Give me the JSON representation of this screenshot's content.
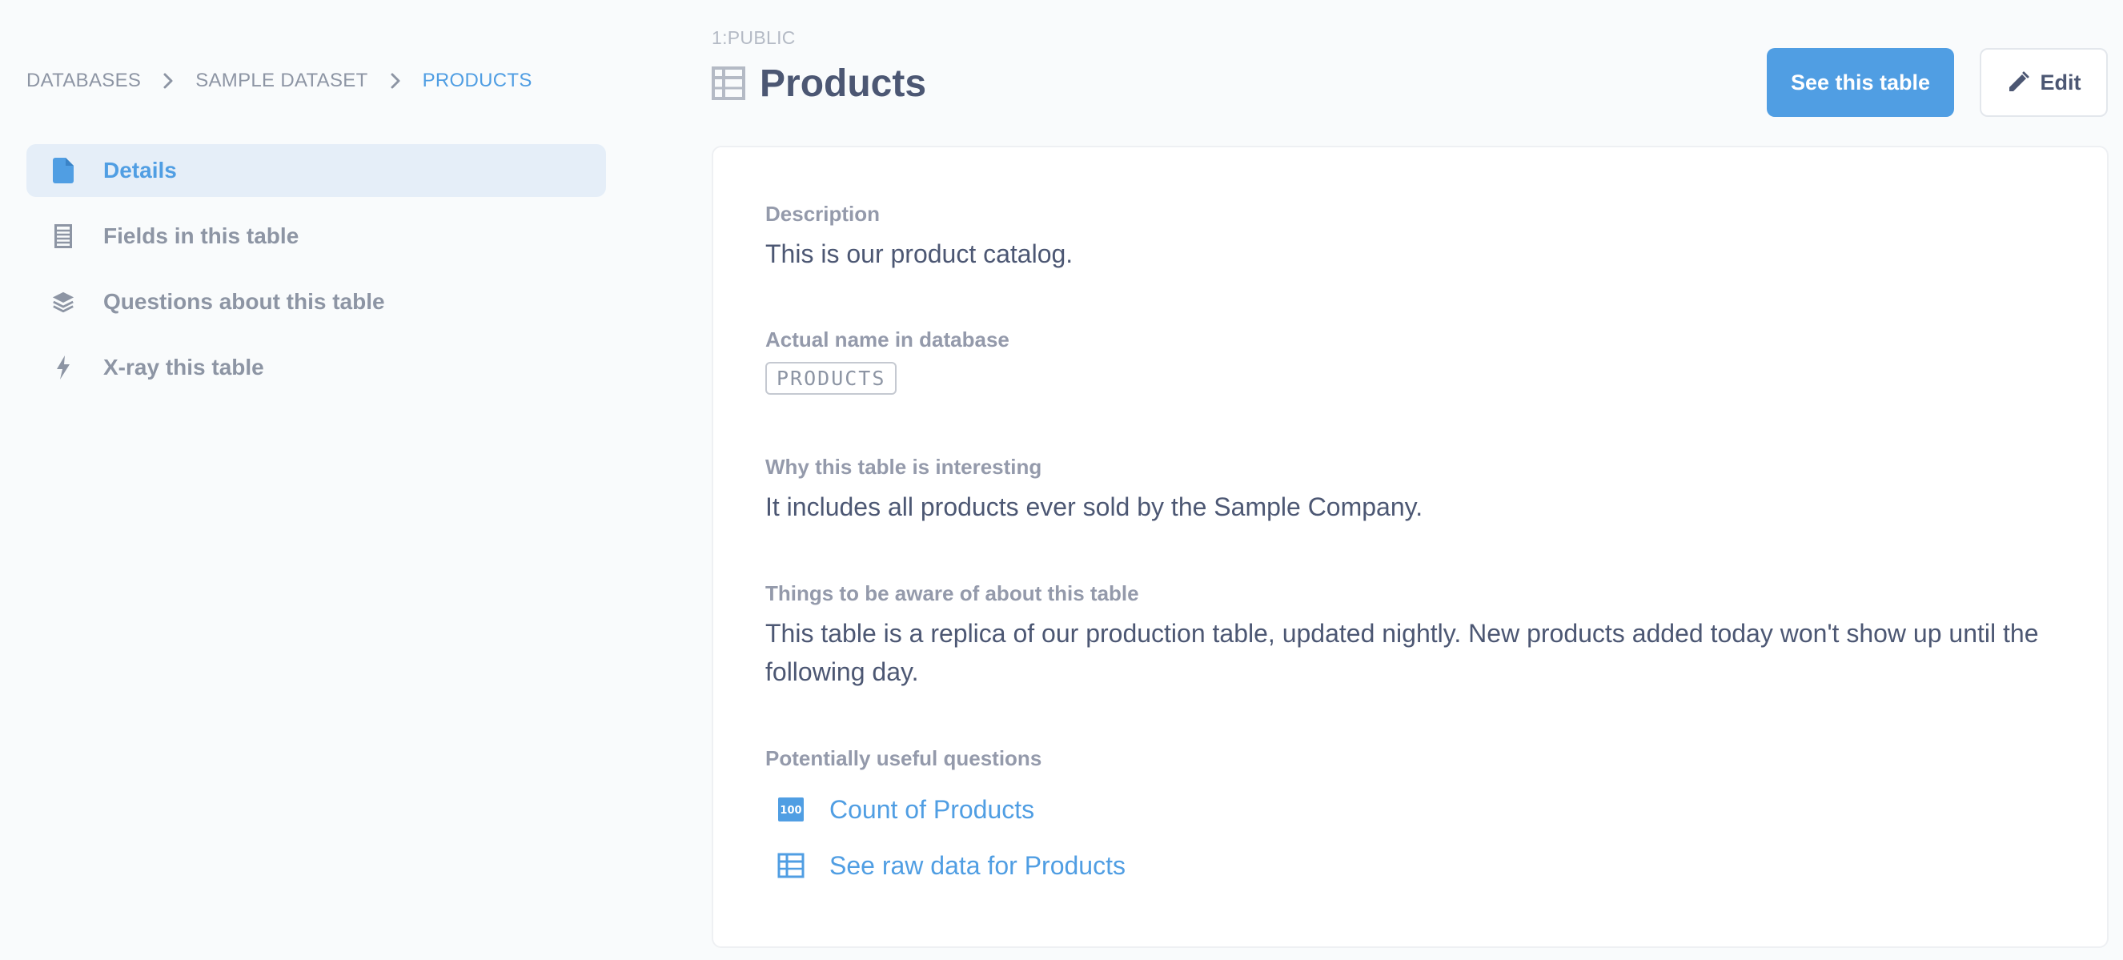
{
  "breadcrumb": {
    "items": [
      "DATABASES",
      "SAMPLE DATASET",
      "PRODUCTS"
    ]
  },
  "sidebar": {
    "items": [
      {
        "label": "Details",
        "icon": "document-icon",
        "active": true
      },
      {
        "label": "Fields in this table",
        "icon": "list-icon",
        "active": false
      },
      {
        "label": "Questions about this table",
        "icon": "layers-icon",
        "active": false
      },
      {
        "label": "X-ray this table",
        "icon": "bolt-icon",
        "active": false
      }
    ]
  },
  "header": {
    "schema": "1:PUBLIC",
    "title": "Products",
    "title_icon": "table-icon",
    "see_table_label": "See this table",
    "edit_label": "Edit"
  },
  "details": {
    "description": {
      "label": "Description",
      "text": "This is our product catalog."
    },
    "actual_name": {
      "label": "Actual name in database",
      "value": "PRODUCTS"
    },
    "interesting": {
      "label": "Why this table is interesting",
      "text": "It includes all products ever sold by the Sample Company."
    },
    "caveats": {
      "label": "Things to be aware of about this table",
      "text": "This table is a replica of our production table, updated nightly. New products added today won't show up until the following day."
    },
    "useful_questions": {
      "label": "Potentially useful questions",
      "items": [
        {
          "label": "Count of Products",
          "icon": "number-100-icon"
        },
        {
          "label": "See raw data for Products",
          "icon": "table-icon"
        }
      ]
    }
  },
  "colors": {
    "brand": "#509ee3",
    "text_dark": "#4c5773",
    "text_light": "#8d95a4",
    "active_bg": "#e5eef8",
    "page_bg": "#f9fbfc"
  }
}
